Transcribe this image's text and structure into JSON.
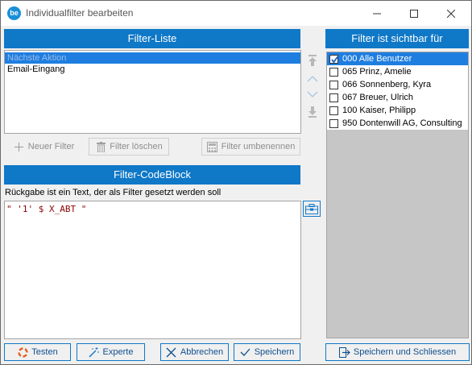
{
  "window": {
    "title": "Individualfilter bearbeiten",
    "icon_text": "be"
  },
  "filter_list": {
    "header": "Filter-Liste",
    "items": [
      {
        "label": "Nächste Aktion",
        "selected": true
      },
      {
        "label": "Email-Eingang",
        "selected": false
      }
    ],
    "buttons": {
      "new": "Neuer Filter",
      "delete": "Filter löschen",
      "rename": "Filter umbenennen"
    }
  },
  "codeblock": {
    "header": "Filter-CodeBlock",
    "hint": "Rückgabe ist ein Text, der als Filter gesetzt werden soll",
    "code": "\" '1' $ X_ABT \""
  },
  "visibility": {
    "header": "Filter ist sichtbar für",
    "items": [
      {
        "label": "000 Alle Benutzer",
        "checked": true,
        "selected": true
      },
      {
        "label": "065 Prinz, Amelie",
        "checked": false,
        "selected": false
      },
      {
        "label": "066 Sonnenberg, Kyra",
        "checked": false,
        "selected": false
      },
      {
        "label": "067 Breuer, Ulrich",
        "checked": false,
        "selected": false
      },
      {
        "label": "100 Kaiser, Philipp",
        "checked": false,
        "selected": false
      },
      {
        "label": "950 Dontenwill AG, Consulting",
        "checked": false,
        "selected": false
      }
    ]
  },
  "footer": {
    "test": "Testen",
    "expert": "Experte",
    "cancel": "Abbrechen",
    "save": "Speichern",
    "save_close": "Speichern und Schliessen"
  },
  "colors": {
    "header_blue": "#0f78c7",
    "selection_blue": "#1e7ee0",
    "code_red": "#8b0000"
  }
}
